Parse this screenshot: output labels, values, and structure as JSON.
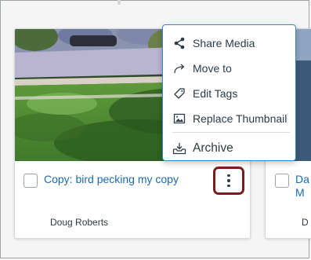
{
  "cards": [
    {
      "title": "Copy: bird pecking my copy",
      "owner": "Doug Roberts"
    },
    {
      "title_line1": "Da",
      "title_line2": "M",
      "owner": "D"
    }
  ],
  "menu": {
    "items": [
      {
        "label": "Share Media",
        "icon": "share-icon"
      },
      {
        "label": "Move to",
        "icon": "move-arrow-icon"
      },
      {
        "label": "Edit Tags",
        "icon": "tag-icon"
      },
      {
        "label": "Replace Thumbnail",
        "icon": "image-icon"
      },
      {
        "label": "Archive",
        "icon": "archive-icon"
      }
    ]
  },
  "colors": {
    "link": "#1a6bb1",
    "kebab_focus": "#7b1c1c",
    "menu_border": "#3a86c8"
  }
}
